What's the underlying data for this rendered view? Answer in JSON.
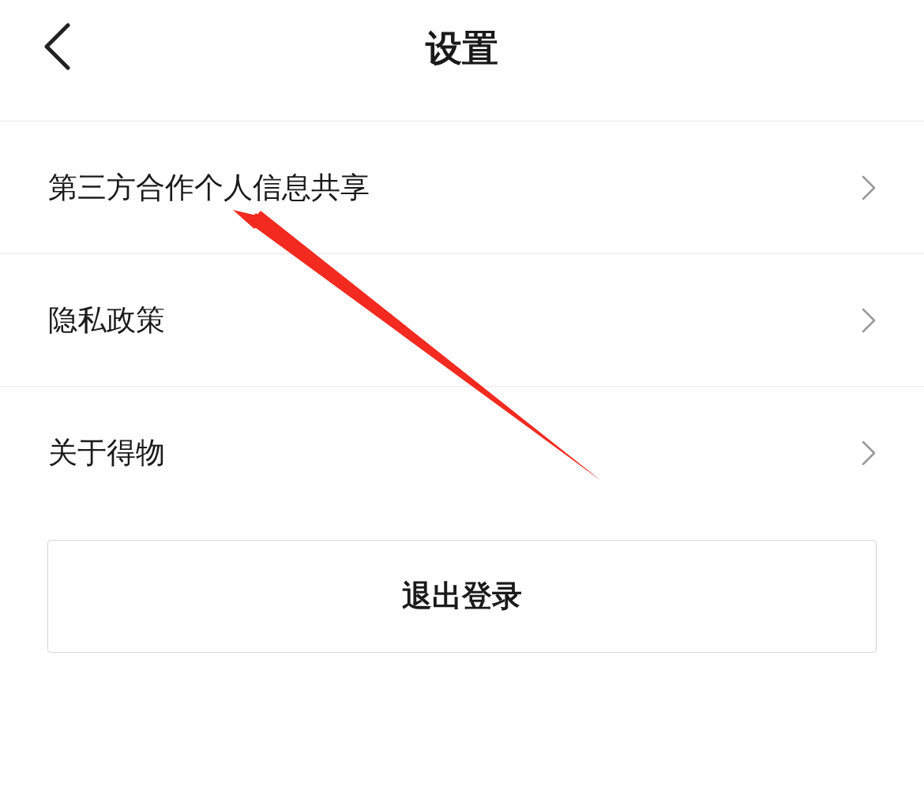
{
  "header": {
    "title": "设置"
  },
  "menu_items": [
    {
      "label": "第三方合作个人信息共享"
    },
    {
      "label": "隐私政策"
    },
    {
      "label": "关于得物"
    }
  ],
  "logout_button": {
    "label": "退出登录"
  }
}
